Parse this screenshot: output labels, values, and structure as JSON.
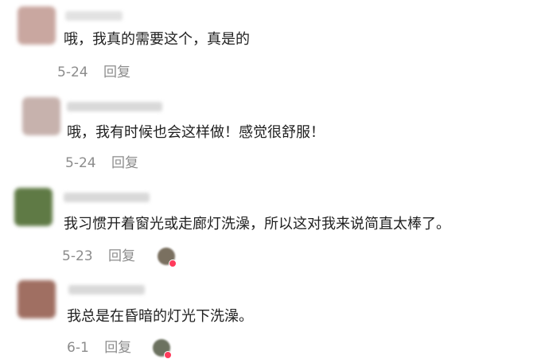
{
  "comments": [
    {
      "text": "哦，我真的需要这个，真是的",
      "date": "5-24",
      "reply_label": "回复",
      "avatar_color": "#c9a7a0",
      "has_reply_avatar": false
    },
    {
      "text": "哦，我有时候也会这样做！感觉很舒服！",
      "date": "5-24",
      "reply_label": "回复",
      "avatar_color": "#c7b2ad",
      "has_reply_avatar": false
    },
    {
      "text": "我习惯开着窗光或走廊灯洗澡，所以这对我来说简直太棒了。",
      "date": "5-23",
      "reply_label": "回复",
      "avatar_color": "#5f7a45",
      "has_reply_avatar": true,
      "reply_avatar_color": "#7a7060"
    },
    {
      "text": "我总是在昏暗的灯光下洗澡。",
      "date": "6-1",
      "reply_label": "回复",
      "avatar_color": "#a06f62",
      "has_reply_avatar": true,
      "reply_avatar_color": "#6c7260"
    }
  ]
}
